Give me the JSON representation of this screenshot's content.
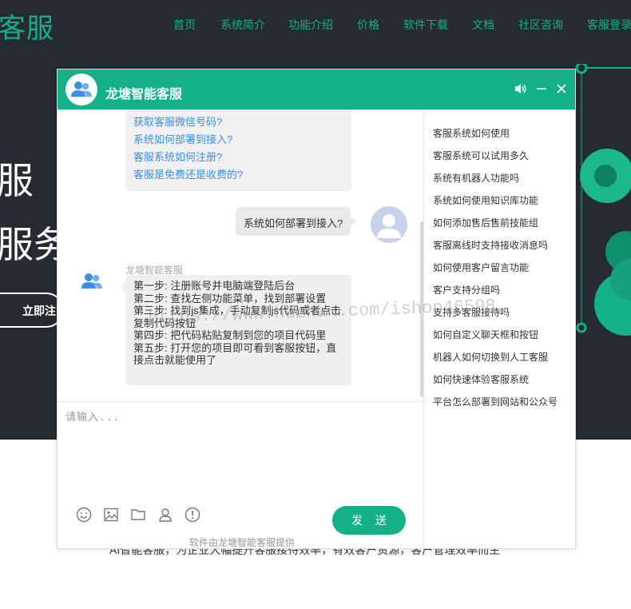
{
  "site": {
    "logo": "客服",
    "nav": [
      "首页",
      "系统简介",
      "功能介绍",
      "价格",
      "软件下载",
      "文档",
      "社区咨询",
      "客服登录"
    ],
    "hero_line1": "服",
    "hero_line2": "服务",
    "hero_button": "立即注",
    "lower_text": "AI智能客服，为企业大幅提升客服接待效率，有效客户资源，客户管理效率而生"
  },
  "chat": {
    "title": "龙塘智能客服",
    "faq_links": [
      "获取客服微信号码?",
      "系统如何部署到接入?",
      "客服系统如何注册?",
      "客服是免费还是收费的?"
    ],
    "user_message": "系统如何部署到接入?",
    "bot_name": "龙塘智能客服",
    "bot_reply": [
      "第一步: 注册账号并电脑端登陆后台",
      "第二步: 查找左侧功能菜单，找到部署设置",
      "第三步: 找到js集成，手动复制js代码或者点击复制代码按钮",
      "第四步: 把代码粘贴复制到您的项目代码里",
      "第五步: 打开您的项目即可看到客服按钮，直接点击就能使用了"
    ],
    "input_placeholder": "请输入...",
    "send_label": "发 送",
    "powered_by": "软件由龙塘智能客服提供",
    "questions": [
      "客服系统如何使用",
      "客服系统可以试用多久",
      "系统有机器人功能吗",
      "系统如何使用知识库功能",
      "如何添加售后售前技能组",
      "客服离线时支持接收消息吗",
      "如何使用客户留言功能",
      "客户支持分组吗",
      "支持多客服接待吗",
      "如何自定义聊天框和按钮",
      "机器人如何切换到人工客服",
      "如何快速体验客服系统",
      "平台怎么部署到网站和公众号"
    ],
    "watermark": "https://www.huzhan.com/ishop46598"
  },
  "colors": {
    "brand": "#13b08a",
    "hero_bg": "#252a33",
    "link": "#3a8ee6"
  }
}
